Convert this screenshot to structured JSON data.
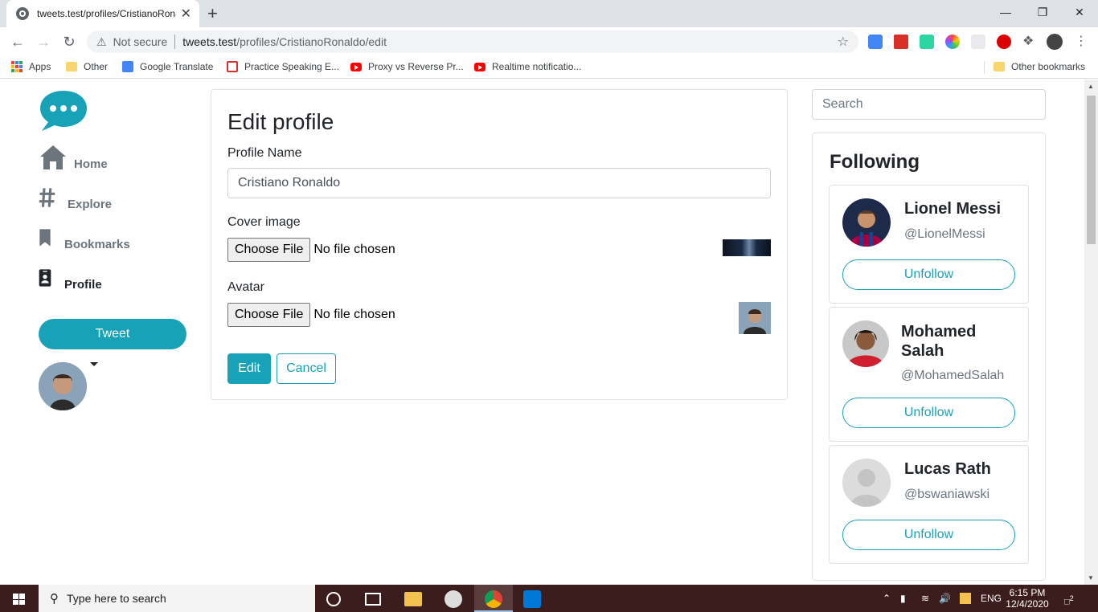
{
  "browser": {
    "tab_title": "tweets.test/profiles/CristianoRonaldo/edit",
    "tab_close": "✕",
    "new_tab": "+",
    "window_controls": {
      "minimize": "—",
      "restore": "❐",
      "close": "✕"
    },
    "security_label": "Not secure",
    "url_host": "tweets.test",
    "url_path": "/profiles/CristianoRonaldo/edit",
    "bookmarks": [
      {
        "label": "Apps",
        "icon": "apps-grid-icon"
      },
      {
        "label": "Other",
        "icon": "folder-icon"
      },
      {
        "label": "Google Translate",
        "icon": "google-translate-icon"
      },
      {
        "label": "Practice Speaking E...",
        "icon": "practice-icon"
      },
      {
        "label": "Proxy vs Reverse Pr...",
        "icon": "youtube-icon"
      },
      {
        "label": "Realtime notificatio...",
        "icon": "youtube-icon"
      }
    ],
    "other_bookmarks": "Other bookmarks"
  },
  "sidebar": {
    "nav": [
      {
        "label": "Home",
        "icon": "home-icon",
        "active": false
      },
      {
        "label": "Explore",
        "icon": "hashtag-icon",
        "active": false
      },
      {
        "label": "Bookmarks",
        "icon": "bookmark-icon",
        "active": false
      },
      {
        "label": "Profile",
        "icon": "id-badge-icon",
        "active": true
      }
    ],
    "tweet_button": "Tweet"
  },
  "edit_form": {
    "title": "Edit profile",
    "name_label": "Profile Name",
    "name_value": "Cristiano Ronaldo",
    "cover_label": "Cover image",
    "avatar_label": "Avatar",
    "choose_file": "Choose File",
    "no_file": "No file chosen",
    "edit_button": "Edit",
    "cancel_button": "Cancel"
  },
  "right": {
    "search_placeholder": "Search",
    "following_title": "Following",
    "following": [
      {
        "name": "Lionel Messi",
        "handle": "@LionelMessi",
        "button": "Unfollow"
      },
      {
        "name": "Mohamed Salah",
        "handle": "@MohamedSalah",
        "button": "Unfollow"
      },
      {
        "name": "Lucas Rath",
        "handle": "@bswaniawski",
        "button": "Unfollow"
      }
    ]
  },
  "taskbar": {
    "search_text": "Type here to search",
    "language": "ENG",
    "time": "6:15 PM",
    "date": "12/4/2020",
    "notification_count": "2"
  },
  "colors": {
    "accent": "#17a2b8",
    "taskbar": "#3c1d1d"
  }
}
